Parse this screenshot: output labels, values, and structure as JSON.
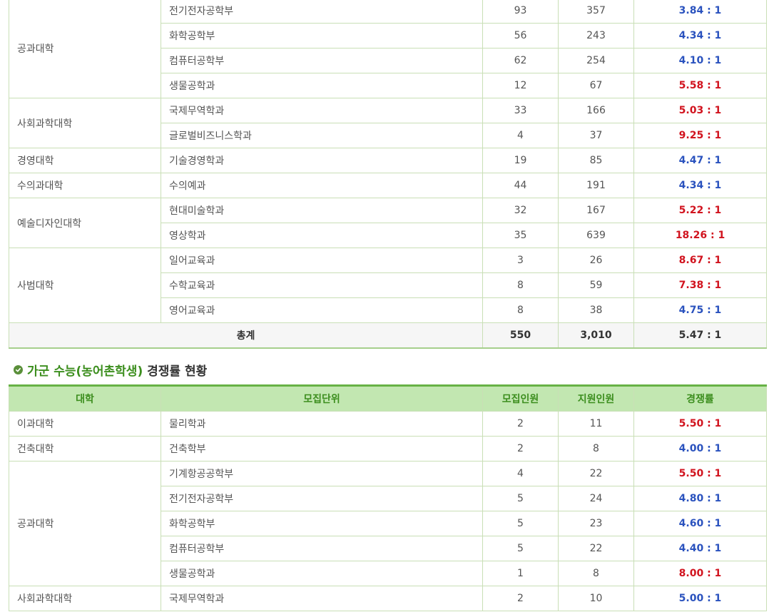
{
  "table1": {
    "rows": [
      {
        "dept": "전기전자공학부",
        "quota": "93",
        "applicants": "357",
        "ratio": "3.84 : 1"
      },
      {
        "dept": "화학공학부",
        "quota": "56",
        "applicants": "243",
        "ratio": "4.34 : 1"
      },
      {
        "dept": "컴퓨터공학부",
        "quota": "62",
        "applicants": "254",
        "ratio": "4.10 : 1"
      },
      {
        "dept": "생물공학과",
        "quota": "12",
        "applicants": "67",
        "ratio": "5.58 : 1"
      },
      {
        "dept": "국제무역학과",
        "quota": "33",
        "applicants": "166",
        "ratio": "5.03 : 1"
      },
      {
        "dept": "글로벌비즈니스학과",
        "quota": "4",
        "applicants": "37",
        "ratio": "9.25 : 1"
      },
      {
        "dept": "기술경영학과",
        "quota": "19",
        "applicants": "85",
        "ratio": "4.47 : 1"
      },
      {
        "dept": "수의예과",
        "quota": "44",
        "applicants": "191",
        "ratio": "4.34 : 1"
      },
      {
        "dept": "현대미술학과",
        "quota": "32",
        "applicants": "167",
        "ratio": "5.22 : 1"
      },
      {
        "dept": "영상학과",
        "quota": "35",
        "applicants": "639",
        "ratio": "18.26 : 1"
      },
      {
        "dept": "일어교육과",
        "quota": "3",
        "applicants": "26",
        "ratio": "8.67 : 1"
      },
      {
        "dept": "수학교육과",
        "quota": "8",
        "applicants": "59",
        "ratio": "7.38 : 1"
      },
      {
        "dept": "영어교육과",
        "quota": "8",
        "applicants": "38",
        "ratio": "4.75 : 1"
      }
    ],
    "colleges": [
      "공과대학",
      "사회과학대학",
      "경영대학",
      "수의과대학",
      "예술디자인대학",
      "사범대학"
    ],
    "total": {
      "label": "총계",
      "quota": "550",
      "applicants": "3,010",
      "ratio": "5.47 : 1"
    }
  },
  "section2": {
    "title_prefix": "가군 수능(농어촌학생)",
    "title_suffix": "경쟁률 현황"
  },
  "table2": {
    "headers": [
      "대학",
      "모집단위",
      "모집인원",
      "지원인원",
      "경쟁률"
    ],
    "colleges": [
      "이과대학",
      "건축대학",
      "공과대학",
      "사회과학대학"
    ],
    "rows": [
      {
        "dept": "물리학과",
        "quota": "2",
        "applicants": "11",
        "ratio": "5.50 : 1"
      },
      {
        "dept": "건축학부",
        "quota": "2",
        "applicants": "8",
        "ratio": "4.00 : 1"
      },
      {
        "dept": "기계항공공학부",
        "quota": "4",
        "applicants": "22",
        "ratio": "5.50 : 1"
      },
      {
        "dept": "전기전자공학부",
        "quota": "5",
        "applicants": "24",
        "ratio": "4.80 : 1"
      },
      {
        "dept": "화학공학부",
        "quota": "5",
        "applicants": "23",
        "ratio": "4.60 : 1"
      },
      {
        "dept": "컴퓨터공학부",
        "quota": "5",
        "applicants": "22",
        "ratio": "4.40 : 1"
      },
      {
        "dept": "생물공학과",
        "quota": "1",
        "applicants": "8",
        "ratio": "8.00 : 1"
      },
      {
        "dept": "국제무역학과",
        "quota": "2",
        "applicants": "10",
        "ratio": "5.00 : 1"
      }
    ]
  },
  "colors": {
    "ratio_high": "#d1131e",
    "ratio_low": "#2a52be",
    "accent_green": "#3c8e1e",
    "header_bg": "#c2e7b1"
  }
}
